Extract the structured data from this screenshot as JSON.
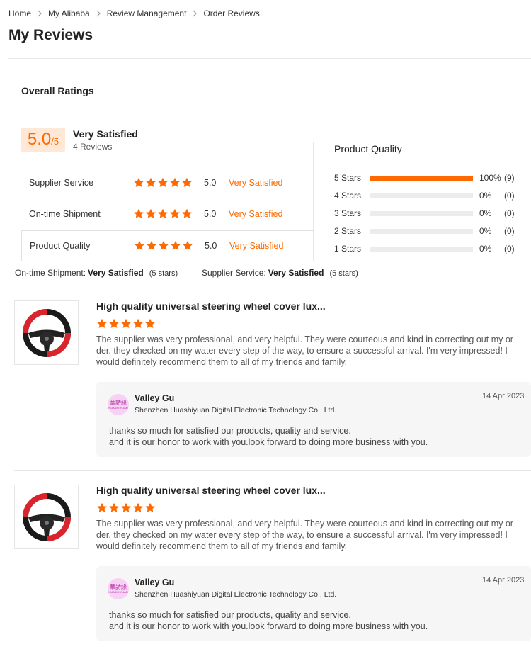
{
  "breadcrumb": [
    "Home",
    "My Alibaba",
    "Review Management",
    "Order Reviews"
  ],
  "page_title": "My Reviews",
  "overall": {
    "title": "Overall Ratings",
    "score": "5.0",
    "score_suffix": "/5",
    "label": "Very Satisfied",
    "count": "4 Reviews",
    "rating_stars": 5
  },
  "categories": [
    {
      "name": "Supplier Service",
      "score": "5.0",
      "label": "Very Satisfied",
      "stars": 5
    },
    {
      "name": "On-time Shipment",
      "score": "5.0",
      "label": "Very Satisfied",
      "stars": 5
    },
    {
      "name": "Product Quality",
      "score": "5.0",
      "label": "Very Satisfied",
      "stars": 5
    }
  ],
  "distribution": {
    "title": "Product Quality",
    "rows": [
      {
        "label": "5  Stars",
        "fill": 1.0,
        "pct": "100%",
        "count": "(9)"
      },
      {
        "label": "4  Stars",
        "fill": 0,
        "pct": "0%",
        "count": "(0)"
      },
      {
        "label": "3  Stars",
        "fill": 0,
        "pct": "0%",
        "count": "(0)"
      },
      {
        "label": "2  Stars",
        "fill": 0,
        "pct": "0%",
        "count": "(0)"
      },
      {
        "label": "1  Stars",
        "fill": 0,
        "pct": "0%",
        "count": "(0)"
      }
    ]
  },
  "summary": [
    {
      "label": "On-time Shipment:",
      "value": "Very Satisfied",
      "stars": "(5 stars)"
    },
    {
      "label": "Supplier Service:",
      "value": "Very Satisfied",
      "stars": "(5 stars)"
    }
  ],
  "reviews": [
    {
      "title": "High quality universal steering wheel cover lux...",
      "stars": 5,
      "text": "The supplier was very professional, and very helpful. They were courteous and kind in correcting out my order.  they checked on my water every step of the way, to ensure a successful arrival. I'm very impressed! I would definitely recommend them to all of my friends and family.",
      "reply": {
        "name": "Valley Gu",
        "company": "Shenzhen Huashiyuan Digital Electronic Technology Co., Ltd.",
        "date": "14 Apr 2023",
        "text_line1": "thanks so much for satisfied our products, quality and service.",
        "text_line2": "and it is our honor to work with you.look forward to doing more business with you.",
        "avatar_text": "華詩緣",
        "avatar_subtext": "HUASHI YUAN"
      }
    },
    {
      "title": "High quality universal steering wheel cover lux...",
      "stars": 5,
      "text": "The supplier was very professional, and very helpful. They were courteous and kind in correcting out my order.  they checked on my water every step of the way, to ensure a successful arrival. I'm very impressed! I would definitely recommend them to all of my friends and family.",
      "reply": {
        "name": "Valley Gu",
        "company": "Shenzhen Huashiyuan Digital Electronic Technology Co., Ltd.",
        "date": "14 Apr 2023",
        "text_line1": "thanks so much for satisfied our products, quality and service.",
        "text_line2": "and it is our honor to work with you.look forward to doing more business with you.",
        "avatar_text": "華詩緣",
        "avatar_subtext": "HUASHI YUAN"
      }
    }
  ],
  "colors": {
    "accent": "#ff6a00",
    "score_bg": "#ffe8d5",
    "reply_bg": "#f6f6f7"
  }
}
